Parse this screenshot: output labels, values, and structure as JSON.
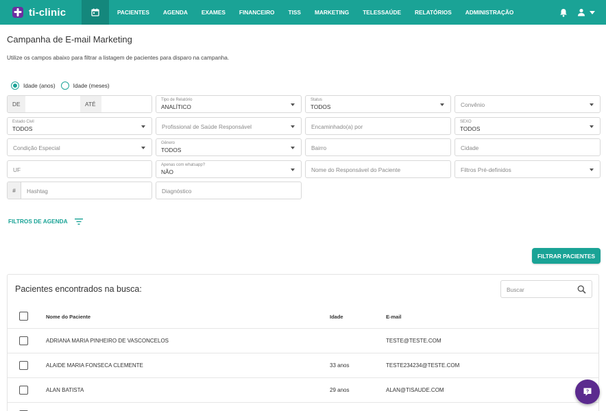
{
  "brand": {
    "name": "ti-clinic",
    "logo_color": "#6b2fa0"
  },
  "colors": {
    "primary": "#1aa396",
    "primary_dark": "#14877c",
    "help": "#5b2a8e"
  },
  "nav": {
    "items": [
      "PACIENTES",
      "AGENDA",
      "EXAMES",
      "FINANCEIRO",
      "TISS",
      "MARKETING",
      "TELESSAÚDE",
      "RELATÓRIOS",
      "ADMINISTRAÇÃO"
    ],
    "icons": [
      "calendar-icon",
      "bell-icon",
      "user-icon",
      "caret-down-icon"
    ]
  },
  "page": {
    "title": "Campanha de E-mail Marketing",
    "description": "Utilize os campos abaixo para filtrar a listagem de pacientes para disparo na campanha."
  },
  "age_mode": {
    "options": [
      "Idade (anos)",
      "Idade (meses)"
    ],
    "selected": "Idade (anos)"
  },
  "filters": {
    "de_label": "DE",
    "ate_label": "ATÉ",
    "tipo_relatorio": {
      "label": "Tipo de Relatório",
      "value": "ANALÍTICO"
    },
    "status": {
      "label": "Status",
      "value": "TODOS"
    },
    "convenio": {
      "placeholder": "Convênio"
    },
    "estado_civil": {
      "label": "Estado Civil",
      "value": "TODOS"
    },
    "profissional": {
      "placeholder": "Profissional de Saúde Responsável"
    },
    "encaminhado": {
      "placeholder": "Encaminhado(a) por"
    },
    "sexo": {
      "label": "SEXO",
      "value": "TODOS"
    },
    "condicao": {
      "placeholder": "Condição Especial"
    },
    "genero": {
      "label": "Gênero",
      "value": "TODOS"
    },
    "bairro": {
      "placeholder": "Bairro"
    },
    "cidade": {
      "placeholder": "Cidade"
    },
    "uf": {
      "placeholder": "UF"
    },
    "whatsapp": {
      "label": "Apenas com whatsapp?",
      "value": "NÃO"
    },
    "responsavel": {
      "placeholder": "Nome do Responsável do Paciente"
    },
    "filtros_predef": {
      "placeholder": "Filtros Pré-definidos"
    },
    "hashtag": {
      "prefix": "#",
      "placeholder": "Hashtag"
    },
    "diagnostico": {
      "placeholder": "Diagnóstico"
    }
  },
  "filtros_agenda_label": "FILTROS DE AGENDA",
  "filtrar_button": "FILTRAR PACIENTES",
  "results": {
    "title": "Pacientes encontrados na busca:",
    "search_placeholder": "Buscar",
    "columns": {
      "name": "Nome do Paciente",
      "age": "Idade",
      "email": "E-mail"
    },
    "rows": [
      {
        "name": "ADRIANA MARIA PINHEIRO DE VASCONCELOS",
        "age": "",
        "email": "TESTE@TESTE.COM"
      },
      {
        "name": "ALAIDE MARIA FONSECA CLEMENTE",
        "age": "33 anos",
        "email": "TESTE234234@TESTE.COM"
      },
      {
        "name": "ALAN BATISTA",
        "age": "29 anos",
        "email": "ALAN@TISAUDE.COM"
      }
    ]
  }
}
